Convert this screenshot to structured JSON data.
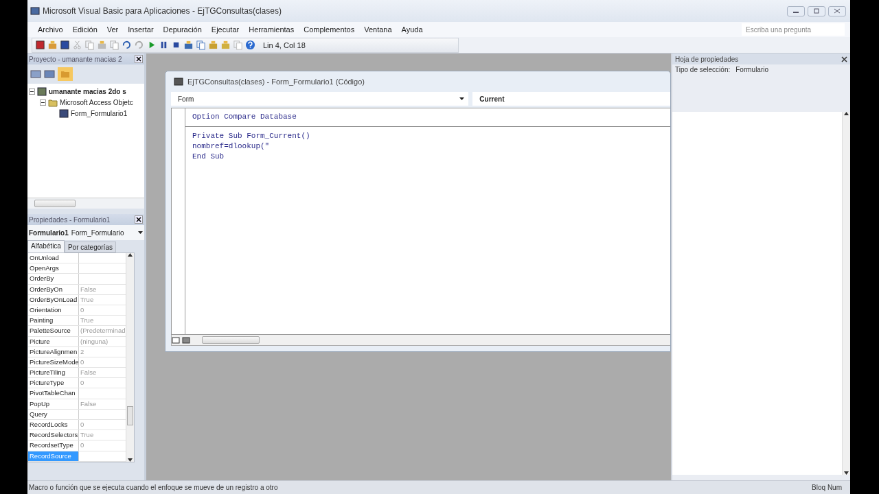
{
  "window": {
    "title": "Microsoft Visual Basic para Aplicaciones - EjTGConsultas(clases)"
  },
  "menu": [
    "Archivo",
    "Edición",
    "Ver",
    "Insertar",
    "Depuración",
    "Ejecutar",
    "Herramientas",
    "Complementos",
    "Ventana",
    "Ayuda"
  ],
  "help_search": {
    "placeholder": "Escriba una pregunta"
  },
  "toolbar": {
    "position": "Lin 4, Col 18"
  },
  "project_explorer": {
    "title": "Proyecto - umanante macias 2",
    "tree": [
      {
        "label": "umanante macias 2do s",
        "expanded": true,
        "children": [
          {
            "label": "Microsoft Access Objetc",
            "expanded": true,
            "children": [
              {
                "label": "Form_Formulario1"
              }
            ]
          }
        ]
      }
    ]
  },
  "properties": {
    "title": "Propiedades - Formulario1",
    "object_name": "Formulario1",
    "object_type": "Form_Formulario",
    "tabs": [
      {
        "label": "Alfabética",
        "selected": true
      },
      {
        "label": "Por categorías",
        "selected": false
      }
    ],
    "rows": [
      {
        "name": "OnUnload",
        "selected": false
      },
      {
        "name": "OpenArgs",
        "selected": false
      },
      {
        "name": "OrderBy",
        "selected": false
      },
      {
        "name": "OrderByOn",
        "value": "False",
        "selected": false
      },
      {
        "name": "OrderByOnLoad",
        "value": "True",
        "selected": false
      },
      {
        "name": "Orientation",
        "value": "0",
        "selected": false
      },
      {
        "name": "Painting",
        "value": "True",
        "selected": false
      },
      {
        "name": "PaletteSource",
        "value": "(Predeterminad",
        "selected": false
      },
      {
        "name": "Picture",
        "value": "(ninguna)",
        "selected": false
      },
      {
        "name": "PictureAlignmen",
        "value": "2",
        "selected": false
      },
      {
        "name": "PictureSizeMode",
        "value": "0",
        "selected": false
      },
      {
        "name": "PictureTiling",
        "value": "False",
        "selected": false
      },
      {
        "name": "PictureType",
        "value": "0",
        "selected": false
      },
      {
        "name": "PivotTableChan",
        "selected": false
      },
      {
        "name": "PopUp",
        "value": "False",
        "selected": false
      },
      {
        "name": "Query",
        "selected": false
      },
      {
        "name": "RecordLocks",
        "value": "0",
        "selected": false
      },
      {
        "name": "RecordSelectors",
        "value": "True",
        "selected": false
      },
      {
        "name": "RecordsetType",
        "value": "0",
        "selected": false
      },
      {
        "name": "RecordSource",
        "selected": true
      }
    ]
  },
  "code_window": {
    "title": "EjTGConsultas(clases) - Form_Formulario1 (Código)",
    "object": "Form",
    "procedure": "Current",
    "sections": [
      {
        "lines": [
          "Option Compare Database"
        ]
      },
      {
        "lines": [
          "Private Sub Form_Current()",
          "nombref=dlookup(\"",
          "End Sub"
        ]
      }
    ]
  },
  "property_sheet": {
    "title": "Hoja de propiedades",
    "selection_label": "Tipo de selección:",
    "selection_value": "Formulario"
  },
  "status_bar": {
    "message": "Macro o función que se ejecuta cuando el enfoque se mueve de un registro a otro",
    "indicator": "Bloq Num"
  }
}
